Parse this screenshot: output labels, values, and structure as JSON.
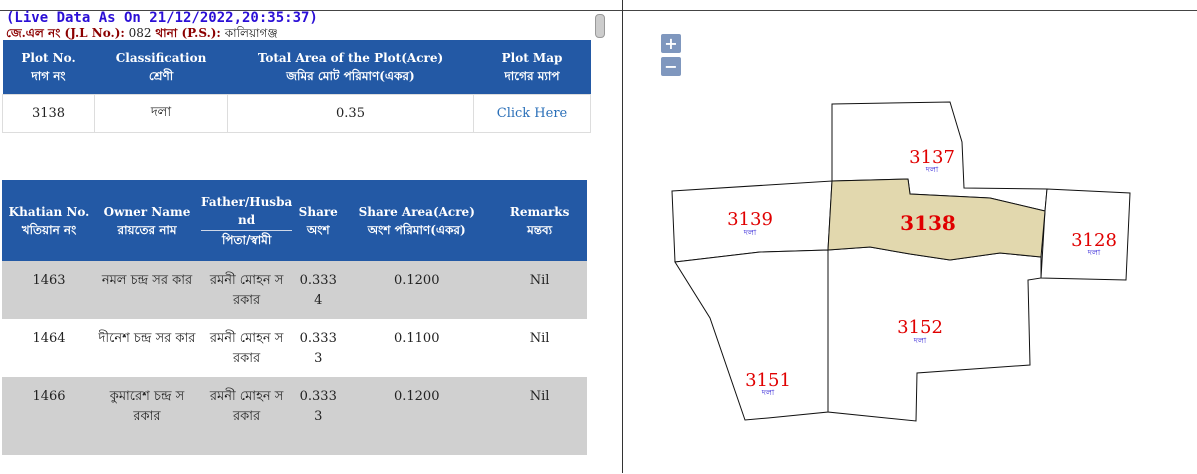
{
  "header": {
    "live_data": "(Live Data As On 21/12/2022,20:35:37)",
    "jl_label": "জে.এল নং (J.L No.):",
    "jl_value": "082",
    "ps_label": "থানা (P.S.):",
    "ps_value": "কালিয়াগঞ্জ"
  },
  "plot_table": {
    "headers": [
      {
        "en": "Plot No.",
        "bn": "দাগ নং"
      },
      {
        "en": "Classification",
        "bn": "শ্রেণী"
      },
      {
        "en": "Total Area of the Plot(Acre)",
        "bn": "জমির মোট পরিমাণ(একর)"
      },
      {
        "en": "Plot Map",
        "bn": "দাগের ম্যাপ"
      }
    ],
    "row": {
      "plot_no": "3138",
      "classification": "দলা",
      "area": "0.35",
      "map_link": "Click Here"
    }
  },
  "owner_table": {
    "headers": [
      {
        "en": "Khatian No.",
        "bn": "খতিয়ান নং"
      },
      {
        "en": "Owner Name",
        "bn": "রায়তের নাম"
      },
      {
        "en": "Father/Husba nd",
        "bn": "পিতা/স্বামী"
      },
      {
        "en": "Share",
        "bn": "অংশ"
      },
      {
        "en": "Share Area(Acre)",
        "bn": "অংশ পরিমাণ(একর)"
      },
      {
        "en": "Remarks",
        "bn": "মন্তব্য"
      }
    ],
    "rows": [
      {
        "khatian": "1463",
        "owner": "নমল চন্দ্র সর কার",
        "father": "রমনী মোহন স রকার",
        "share": "0.333 4",
        "share_area": "0.1200",
        "remarks": "Nil"
      },
      {
        "khatian": "1464",
        "owner": "দীনেশ চন্দ্র সর কার",
        "father": "রমনী মোহন স রকার",
        "share": "0.333 3",
        "share_area": "0.1100",
        "remarks": "Nil"
      },
      {
        "khatian": "1466",
        "owner": "কুমারেশ চন্দ্র স রকার",
        "father": "রমনী মোহন স রকার",
        "share": "0.333 3",
        "share_area": "0.1200",
        "remarks": "Nil"
      }
    ]
  },
  "map": {
    "zoom_in": "+",
    "zoom_out": "−",
    "selected_fill": "#e2d8ae",
    "plots": [
      {
        "id": "3137",
        "class": "দলা"
      },
      {
        "id": "3139",
        "class": "দলা"
      },
      {
        "id": "3138",
        "class": "",
        "selected": true
      },
      {
        "id": "3128",
        "class": "দলা"
      },
      {
        "id": "3152",
        "class": "দলা"
      },
      {
        "id": "3151",
        "class": "দলা"
      }
    ]
  }
}
